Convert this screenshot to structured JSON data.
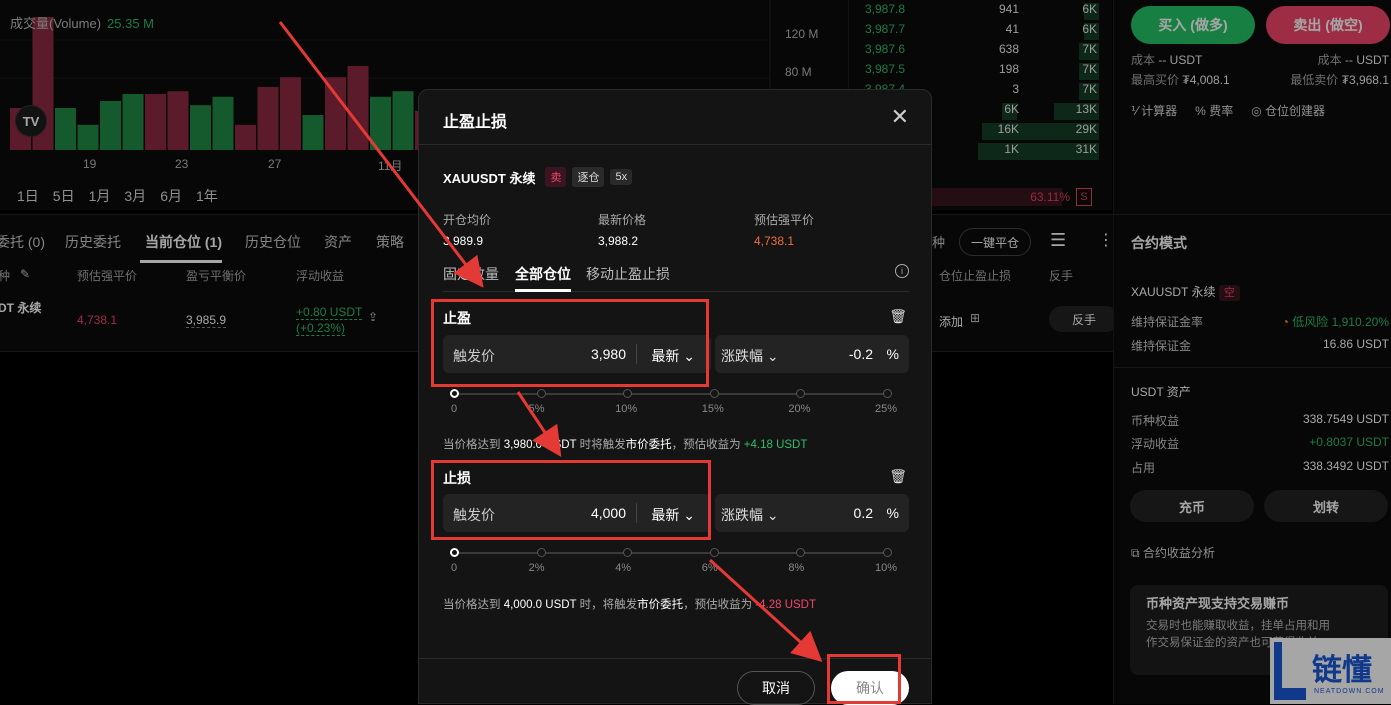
{
  "chart": {
    "volume_label": "成交量(Volume)",
    "volume_value": "25.35 M",
    "y_ticks": [
      "120 M",
      "80 M"
    ],
    "x_ticks": [
      "19",
      "23",
      "27",
      "11月"
    ],
    "ranges": [
      "1日",
      "5日",
      "1月",
      "3月",
      "6月",
      "1年"
    ],
    "tv_logo": "TV",
    "bars": [
      {
        "v": 0.3,
        "c": "red"
      },
      {
        "v": 0.95,
        "c": "red"
      },
      {
        "v": 0.3,
        "c": "green"
      },
      {
        "v": 0.18,
        "c": "green"
      },
      {
        "v": 0.35,
        "c": "green"
      },
      {
        "v": 0.4,
        "c": "green"
      },
      {
        "v": 0.4,
        "c": "red"
      },
      {
        "v": 0.42,
        "c": "red"
      },
      {
        "v": 0.32,
        "c": "green"
      },
      {
        "v": 0.38,
        "c": "green"
      },
      {
        "v": 0.18,
        "c": "red"
      },
      {
        "v": 0.45,
        "c": "red"
      },
      {
        "v": 0.52,
        "c": "red"
      },
      {
        "v": 0.25,
        "c": "green"
      },
      {
        "v": 0.52,
        "c": "red"
      },
      {
        "v": 0.6,
        "c": "red"
      },
      {
        "v": 0.38,
        "c": "green"
      },
      {
        "v": 0.42,
        "c": "green"
      },
      {
        "v": 0.28,
        "c": "red"
      }
    ]
  },
  "order_book": {
    "rows": [
      {
        "price": "3,987.8",
        "qty": "941",
        "total": "6K",
        "depth": 0.1,
        "bid": false
      },
      {
        "price": "3,987.7",
        "qty": "41",
        "total": "6K",
        "depth": 0.1,
        "bid": false
      },
      {
        "price": "3,987.6",
        "qty": "638",
        "total": "7K",
        "depth": 0.13,
        "bid": false
      },
      {
        "price": "3,987.5",
        "qty": "198",
        "total": "7K",
        "depth": 0.13,
        "bid": false
      },
      {
        "price": "3,987.4",
        "qty": "3",
        "total": "7K",
        "depth": 0.13,
        "bid": false
      },
      {
        "price": "",
        "qty": "6K",
        "total": "13K",
        "depth": 0.3,
        "bid": true
      },
      {
        "price": "",
        "qty": "16K",
        "total": "29K",
        "depth": 0.7,
        "bid": true
      },
      {
        "price": "",
        "qty": "1K",
        "total": "31K",
        "depth": 0.78,
        "bid": true
      }
    ],
    "pct": "63.11%",
    "side_badge": "S"
  },
  "trade": {
    "buy": "买入 (做多)",
    "sell": "卖出 (做空)",
    "cost_l_label": "成本",
    "cost_l_val": "-- USDT",
    "cost_r_label": "成本",
    "cost_r_val": "-- USDT",
    "max_buy_label": "最高买价",
    "max_buy_val": "₮4,008.1",
    "min_sell_label": "最低卖价",
    "min_sell_val": "₮3,968.1",
    "tools": [
      "计算器",
      "费率",
      "仓位创建器"
    ]
  },
  "tabs": {
    "items": [
      "委托 (0)",
      "历史委托",
      "当前仓位 (1)",
      "历史仓位",
      "资产",
      "策略"
    ],
    "extra_label": "种",
    "close_all": "一键平仓"
  },
  "columns": [
    "种",
    "预估强平价",
    "盈亏平衡价",
    "浮动收益",
    "仓位止盈止损",
    "反手"
  ],
  "position": {
    "symbol": "DT 永续",
    "liq": "4,738.1",
    "breakeven": "3,985.9",
    "pnl": "+0.80 USDT",
    "pnl_pct": "(+0.23%)",
    "add": "添加",
    "reverse": "反手"
  },
  "right_panel": {
    "title": "合约模式",
    "symbol": "XAUUSDT 永续",
    "side_tag": "空",
    "maint_rate_label": "维持保证金率",
    "maint_rate_val": "低风险 1,910.20%",
    "maint_label": "维持保证金",
    "maint_val": "16.86 USDT",
    "asset_title": "USDT 资产",
    "equity_label": "币种权益",
    "equity_val": "338.7549 USDT",
    "float_label": "浮动收益",
    "float_val": "+0.8037 USDT",
    "used_label": "占用",
    "used_val": "338.3492 USDT",
    "deposit": "充币",
    "transfer": "划转",
    "analysis": "合约收益分析",
    "promo_title": "币种资产现支持交易赚币",
    "promo_text": "交易时也能赚取收益，挂单占用和用作交易保证金的资产也可获得收益",
    "logo_text": "链懂",
    "logo_sub": "NEATDOWN.COM"
  },
  "modal": {
    "title": "止盈止损",
    "symbol": "XAUUSDT 永续",
    "tag_side": "卖",
    "tag_margin": "逐仓",
    "tag_lev": "5x",
    "open_label": "开仓均价",
    "open_val": "3,989.9",
    "last_label": "最新价格",
    "last_val": "3,988.2",
    "liq_label": "预估强平价",
    "liq_val": "4,738.1",
    "tabs": [
      "固定数量",
      "全部仓位",
      "移动止盈止损"
    ],
    "tp": {
      "title": "止盈",
      "trigger_label": "触发价",
      "trigger_val": "3,980",
      "price_type": "最新",
      "change_label": "涨跌幅",
      "change_val": "-0.2",
      "change_unit": "%",
      "ticks": [
        "0",
        "5%",
        "10%",
        "15%",
        "20%",
        "25%"
      ],
      "note_pre": "当价格达到",
      "note_price": "3,980.0 USDT",
      "note_mid": "时将触发",
      "note_type": "市价委托",
      "note_est": "，预估收益为",
      "note_pnl": "+4.18 USDT"
    },
    "sl": {
      "title": "止损",
      "trigger_label": "触发价",
      "trigger_val": "4,000",
      "price_type": "最新",
      "change_label": "涨跌幅",
      "change_val": "0.2",
      "change_unit": "%",
      "ticks": [
        "0",
        "2%",
        "4%",
        "6%",
        "8%",
        "10%"
      ],
      "note_pre": "当价格达到",
      "note_price": "4,000.0 USDT",
      "note_mid": "时，将触发",
      "note_type": "市价委托",
      "note_est": "，预估收益为",
      "note_pnl": "-4.28 USDT"
    },
    "cancel": "取消",
    "confirm": "确认"
  }
}
